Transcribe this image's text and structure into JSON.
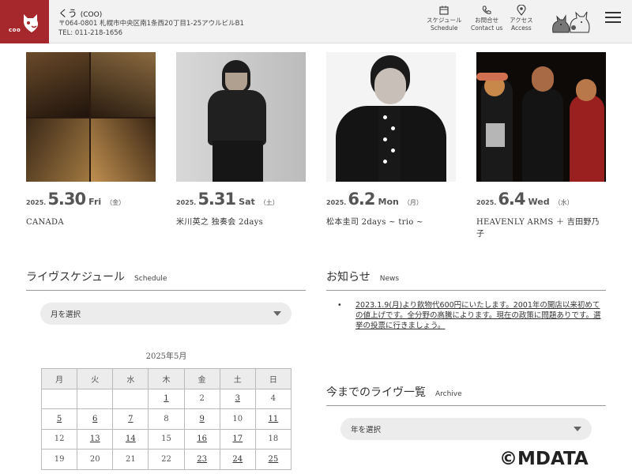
{
  "header": {
    "logo_text": "coo",
    "shop_name": "くう",
    "shop_name_romaji": "(COO)",
    "address": "〒064-0801 札幌市中央区南1条西20丁目1-25アウルビルB1",
    "tel": "TEL: 011-218-1656",
    "nav": [
      {
        "label_jp": "スケジュール",
        "label_en": "Schedule"
      },
      {
        "label_jp": "お問合せ",
        "label_en": "Contact us"
      },
      {
        "label_jp": "アクセス",
        "label_en": "Access"
      }
    ]
  },
  "events": [
    {
      "year": "2025.",
      "monthday": "5.30",
      "dow": "Fri",
      "dow_jp": "（金）",
      "title": "CANADA"
    },
    {
      "year": "2025.",
      "monthday": "5.31",
      "dow": "Sat",
      "dow_jp": "（土）",
      "title": "米川英之 独奏会 2days"
    },
    {
      "year": "2025.",
      "monthday": "6.2",
      "dow": "Mon",
      "dow_jp": "（月）",
      "title": "松本圭司 2days ~ trio ~"
    },
    {
      "year": "2025.",
      "monthday": "6.4",
      "dow": "Wed",
      "dow_jp": "（水）",
      "title": "HEAVENLY ARMS ＋ 吉田野乃子"
    }
  ],
  "schedule": {
    "title_jp": "ライヴスケジュール",
    "title_en": "Schedule",
    "month_select": "月を選択",
    "calendar_caption": "2025年5月",
    "weekdays": [
      "月",
      "火",
      "水",
      "木",
      "金",
      "土",
      "日"
    ],
    "rows": [
      [
        "",
        "",
        "",
        "1",
        "2",
        "3",
        "4"
      ],
      [
        "5",
        "6",
        "7",
        "8",
        "9",
        "10",
        "11"
      ],
      [
        "12",
        "13",
        "14",
        "15",
        "16",
        "17",
        "18"
      ],
      [
        "19",
        "20",
        "21",
        "22",
        "23",
        "24",
        "25"
      ]
    ]
  },
  "news": {
    "title_jp": "お知らせ",
    "title_en": "News",
    "items": [
      "2023.1.9(月)より飲物代600円にいたします。2001年の開店以来初めての値上げです。全分野の高騰によります。現在の政策に問題ありです。選挙の投票に行きましょう。"
    ]
  },
  "archive": {
    "title_jp": "今までのライヴ一覧",
    "title_en": "Archive",
    "year_select": "年を選択"
  },
  "copyright": "©MDATA"
}
